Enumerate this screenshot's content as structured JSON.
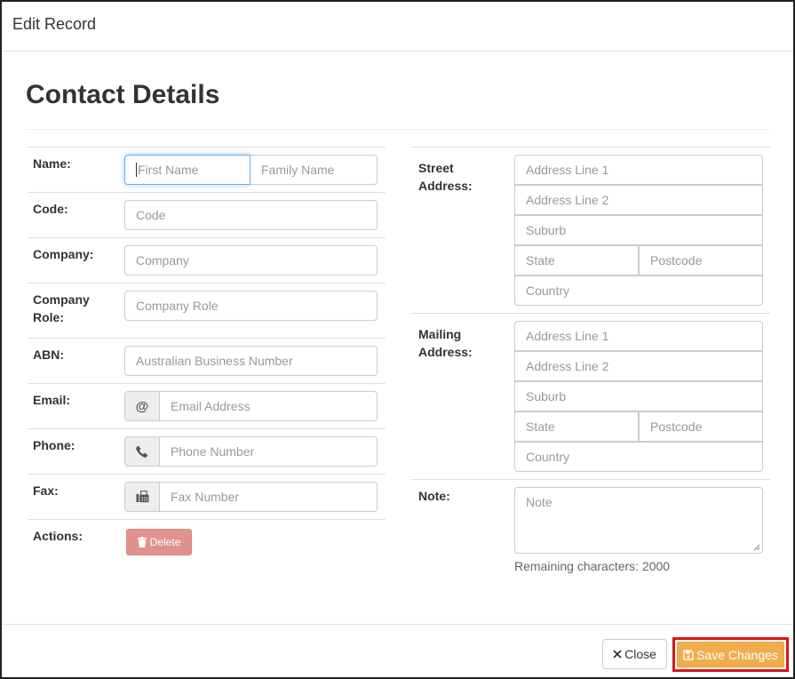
{
  "modal": {
    "title": "Edit Record"
  },
  "page_title": "Contact Details",
  "left": {
    "name_label": "Name:",
    "first_name_placeholder": "First Name",
    "family_name_placeholder": "Family Name",
    "code_label": "Code:",
    "code_placeholder": "Code",
    "company_label": "Company:",
    "company_placeholder": "Company",
    "company_role_label_1": "Company",
    "company_role_label_2": "Role:",
    "company_role_placeholder": "Company Role",
    "abn_label": "ABN:",
    "abn_placeholder": "Australian Business Number",
    "email_label": "Email:",
    "email_addon": "@",
    "email_placeholder": "Email Address",
    "phone_label": "Phone:",
    "phone_placeholder": "Phone Number",
    "fax_label": "Fax:",
    "fax_placeholder": "Fax Number",
    "actions_label": "Actions:",
    "delete_label": "Delete"
  },
  "right": {
    "street": {
      "label_1": "Street",
      "label_2": "Address:",
      "line1": "Address Line 1",
      "line2": "Address Line 2",
      "suburb": "Suburb",
      "state": "State",
      "postcode": "Postcode",
      "country": "Country"
    },
    "mailing": {
      "label_1": "Mailing",
      "label_2": "Address:",
      "line1": "Address Line 1",
      "line2": "Address Line 2",
      "suburb": "Suburb",
      "state": "State",
      "postcode": "Postcode",
      "country": "Country"
    },
    "note_label": "Note:",
    "note_placeholder": "Note",
    "remaining": "Remaining characters: 2000"
  },
  "footer": {
    "close_label": "Close",
    "save_label": "Save Changes"
  },
  "icons": {
    "close": "x-icon",
    "save": "floppy-disk-icon",
    "delete": "trash-icon",
    "email": "at-icon",
    "phone": "phone-icon",
    "fax": "fax-icon"
  },
  "colors": {
    "save_button": "#f0ad4e",
    "save_highlight": "#d9131b",
    "delete_button": "#e0938d",
    "focus_border": "#66afe9"
  }
}
